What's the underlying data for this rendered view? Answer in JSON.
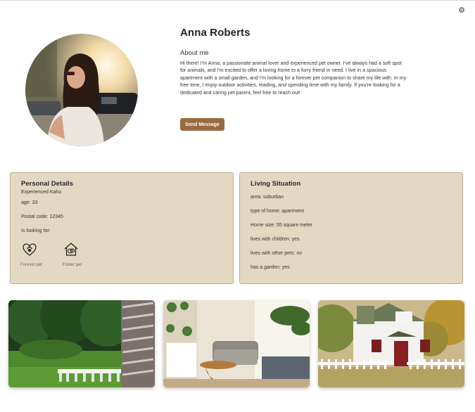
{
  "profile": {
    "name": "Anna Roberts",
    "about_title": "About me",
    "about_text": "Hi there! I'm Anna, a passionate animal lover and experienced pet owner. I've always had a soft spot for animals, and I'm excited to offer a loving home to a furry friend in need. I live in a spacious apartment with a small garden, and I'm looking for a forever pet companion to share my life with. In my free time, I enjoy outdoor activities, reading, and spending time with my family. If you're looking for a dedicated and caring pet parent, feel free to reach out!",
    "send_button": "Send Message"
  },
  "personal": {
    "title": "Personal Details",
    "experience": "Experienced Kahu",
    "age": "age: 33",
    "postal": "Postal code: 12345",
    "looking_for": "Is looking for:",
    "options": [
      {
        "label": "Forever pet",
        "icon": "heart-paw-icon"
      },
      {
        "label": "Foster pet",
        "icon": "house-paw-icon"
      }
    ]
  },
  "living": {
    "title": "Living Situation",
    "items": [
      "area: suburban",
      "type of home: apartment",
      "Home size: 55 square meter",
      "lives with children: yes",
      "lives with other pets: no",
      "has a garden: yes"
    ]
  },
  "icons": {
    "settings": "gear-icon"
  },
  "colors": {
    "accent": "#9a6b42",
    "card_bg": "#e3d8c1",
    "card_border": "#b9ad96"
  }
}
